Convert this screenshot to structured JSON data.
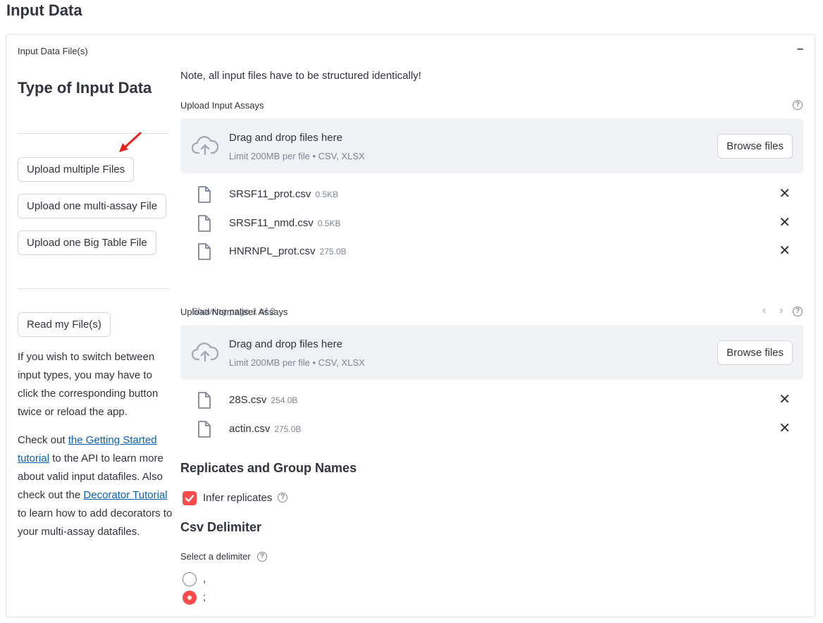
{
  "page_title": "Input Data",
  "expander": {
    "title": "Input Data File(s)",
    "collapse_symbol": "–"
  },
  "left": {
    "heading": "Type of Input Data",
    "buttons": {
      "multiple": "Upload multiple Files",
      "multi_assay": "Upload one multi-assay File",
      "big_table": "Upload one Big Table File",
      "read": "Read my File(s)"
    },
    "switch_text": "If you wish to switch between input types, you may have to click the corresponding button twice or reload the app.",
    "check_out": {
      "prefix": "Check out ",
      "link1": "the Getting Started tutorial",
      "middle": " to the API to learn more about valid input datafiles. Also check out the ",
      "link2": "Decorator Tutorial",
      "suffix": " to learn how to add decorators to your multi-assay datafiles."
    },
    "annotation_color": "#e8231c"
  },
  "note": "Note, all input files have to be structured identically!",
  "assays": {
    "label": "Upload Input Assays",
    "dropzone": {
      "title": "Drag and drop files here",
      "limit": "Limit 200MB per file • CSV, XLSX",
      "browse": "Browse files"
    },
    "files": [
      {
        "name": "SRSF11_prot.csv",
        "size": "0.5KB"
      },
      {
        "name": "SRSF11_nmd.csv",
        "size": "0.5KB"
      },
      {
        "name": "HNRNPL_prot.csv",
        "size": "275.0B"
      }
    ],
    "pager": "Showing page 1 of 2"
  },
  "normalisers": {
    "label": "Upload Normaliser Assays",
    "dropzone": {
      "title": "Drag and drop files here",
      "limit": "Limit 200MB per file • CSV, XLSX",
      "browse": "Browse files"
    },
    "files": [
      {
        "name": "28S.csv",
        "size": "254.0B"
      },
      {
        "name": "actin.csv",
        "size": "275.0B"
      }
    ]
  },
  "replicates": {
    "heading": "Replicates and Group Names",
    "checkbox_label": "Infer replicates",
    "checked": true
  },
  "delimiter": {
    "heading": "Csv Delimiter",
    "label": "Select a delimiter",
    "options": [
      ",",
      ";"
    ],
    "selected": ";"
  },
  "colors": {
    "accent": "#ff4b4b",
    "dropzone_bg": "#f0f2f6",
    "link": "#0b5fb3"
  }
}
